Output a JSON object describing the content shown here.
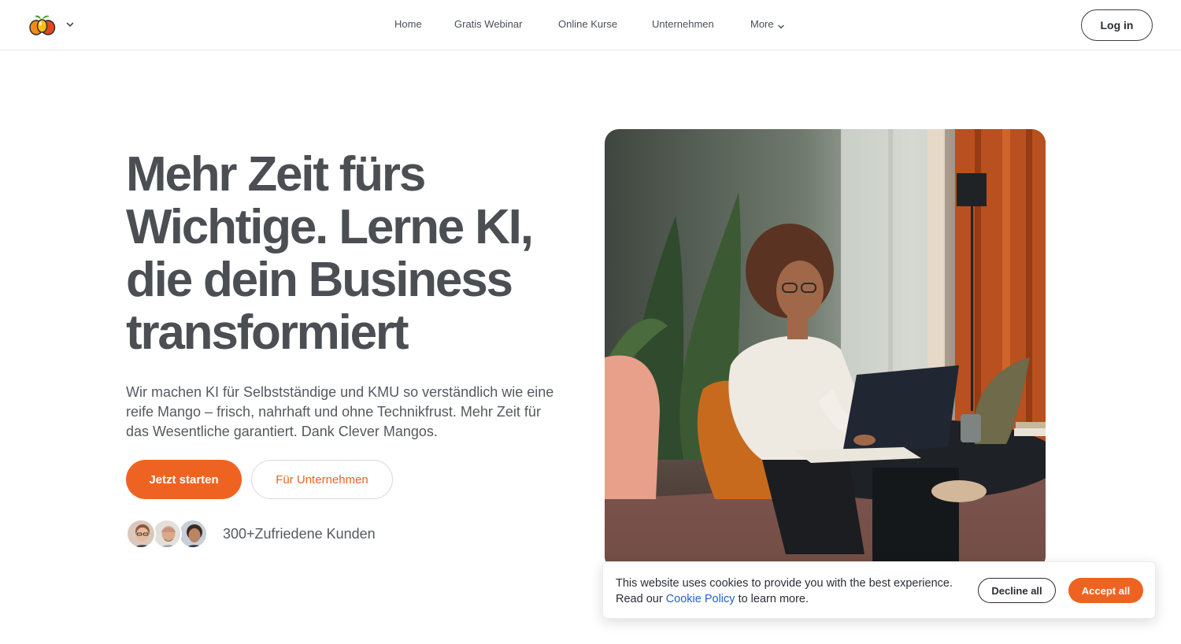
{
  "header": {
    "logo_icon": "mango-fruit-logo-icon",
    "logo_menu_icon": "chevron-down-icon",
    "nav": [
      {
        "label": "Home"
      },
      {
        "label": "Gratis Webinar"
      },
      {
        "label": "Online Kurse"
      },
      {
        "label": "Unternehmen"
      },
      {
        "label": "More",
        "icon": "chevron-down-icon"
      }
    ],
    "login_label": "Log in"
  },
  "hero": {
    "title": "Mehr Zeit fürs Wichtige. Lerne KI, die dein Business transformiert",
    "subtitle": "Wir machen KI für Selbstständige und KMU so verständlich wie eine reife Mango – frisch, nahrhaft und ohne Technikfrust. Mehr Zeit für das Wesentliche garantiert. Dank Clever Mangos.",
    "primary_cta": "Jetzt starten",
    "secondary_cta": "Für Unternehmen",
    "customers_text": "300+Zufriedene Kunden",
    "image_icon": "woman-working-on-laptop-photo"
  },
  "cookie_banner": {
    "text_line1": "This website uses cookies to provide you with the best experience.",
    "text_pre_link": "Read our",
    "link_label": "Cookie Policy",
    "text_post_link": "to learn more.",
    "decline_label": "Decline all",
    "accept_label": "Accept all"
  },
  "colors": {
    "accent": "#ef6322",
    "text": "#4b4f54",
    "link": "#2563c9"
  }
}
